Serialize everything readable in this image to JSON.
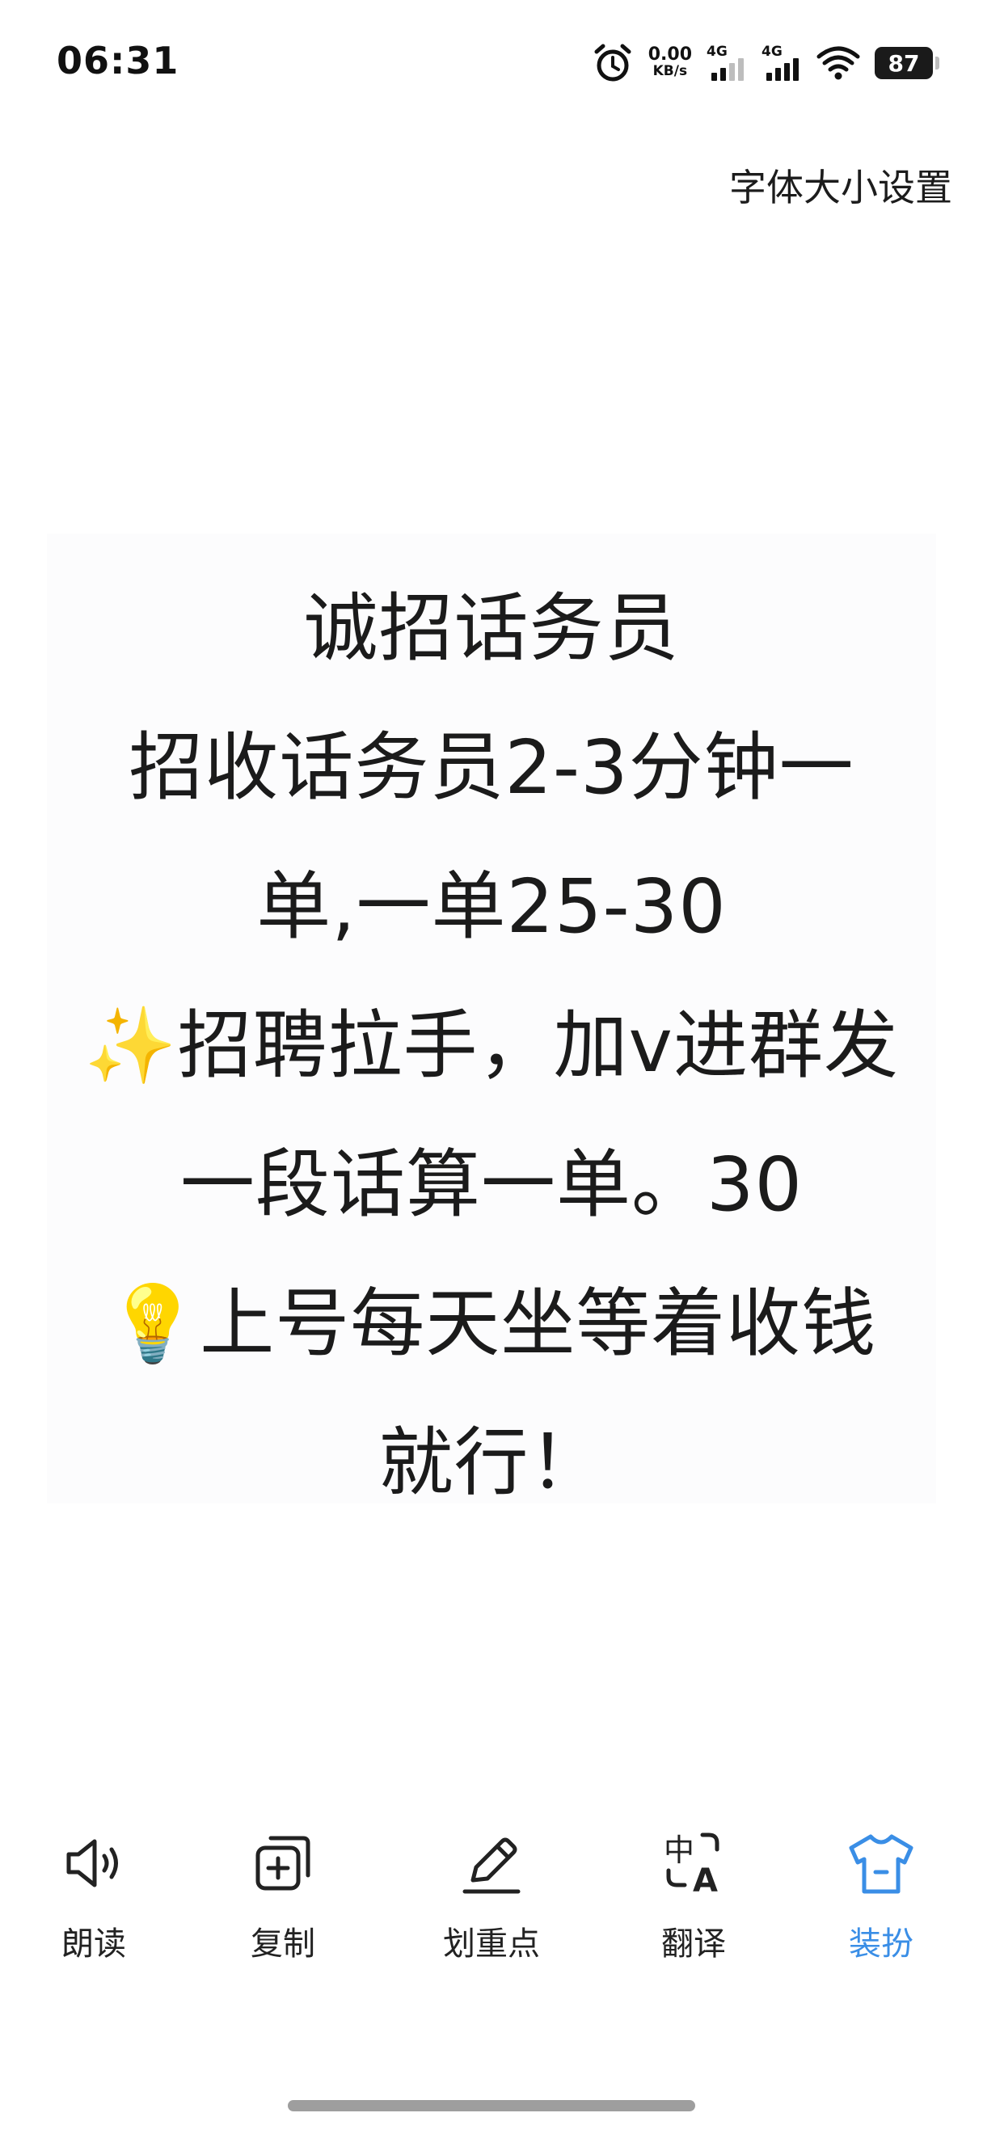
{
  "status_bar": {
    "time": "06:31",
    "net_speed_value": "0.00",
    "net_speed_unit": "KB/s",
    "sim1_label": "4G",
    "sim2_label": "4G",
    "battery": "87"
  },
  "header": {
    "font_size_setting": "字体大小设置"
  },
  "content": {
    "lines": [
      "诚招话务员",
      "招收话务员2-3分钟一",
      "单,一单25-30",
      "✨招聘拉手，加v进群发",
      "一段话算一单。30",
      "💡上号每天坐等着收钱",
      "就行！"
    ]
  },
  "toolbar": {
    "items": [
      {
        "label": "朗读",
        "icon": "speaker-icon"
      },
      {
        "label": "复制",
        "icon": "copy-icon"
      },
      {
        "label": "划重点",
        "icon": "pencil-icon"
      },
      {
        "label": "翻译",
        "icon": "translate-icon"
      },
      {
        "label": "装扮",
        "icon": "tshirt-icon"
      }
    ],
    "active_color": "#3a8ee6"
  }
}
